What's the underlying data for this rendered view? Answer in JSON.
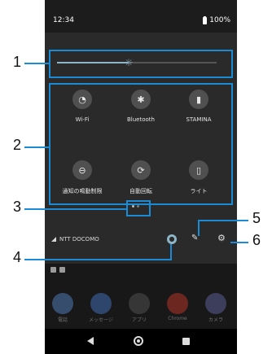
{
  "status_bar": {
    "time": "12:34",
    "battery": "100%"
  },
  "brightness": {
    "level": 0.45
  },
  "tiles": [
    {
      "label": "Wi-Fi",
      "icon": "wifi-icon",
      "glyph": "◔"
    },
    {
      "label": "Bluetooth",
      "icon": "bluetooth-icon",
      "glyph": "✱"
    },
    {
      "label": "STAMINA",
      "icon": "battery-stamina-icon",
      "glyph": "▮"
    },
    {
      "label": "通知の鳴動制限",
      "icon": "do-not-disturb-icon",
      "glyph": "⊖"
    },
    {
      "label": "自動回転",
      "icon": "auto-rotate-icon",
      "glyph": "⟳"
    },
    {
      "label": "ライト",
      "icon": "flashlight-icon",
      "glyph": "▯"
    }
  ],
  "operator": "NTT DOCOMO",
  "apps": [
    {
      "label": "電話",
      "color": "#5b8fd6"
    },
    {
      "label": "メッセージ",
      "color": "#4a7fd0"
    },
    {
      "label": "アプリ",
      "color": "#5a5a5a"
    },
    {
      "label": "Chrome",
      "color": "#d23a2a"
    },
    {
      "label": "カメラ",
      "color": "#6a6ab0"
    }
  ],
  "callouts": [
    "1",
    "2",
    "3",
    "4",
    "5",
    "6"
  ],
  "colors": {
    "accent": "#1c8bd6",
    "panel": "#2a2a2a",
    "slider": "#8fb6c8"
  }
}
